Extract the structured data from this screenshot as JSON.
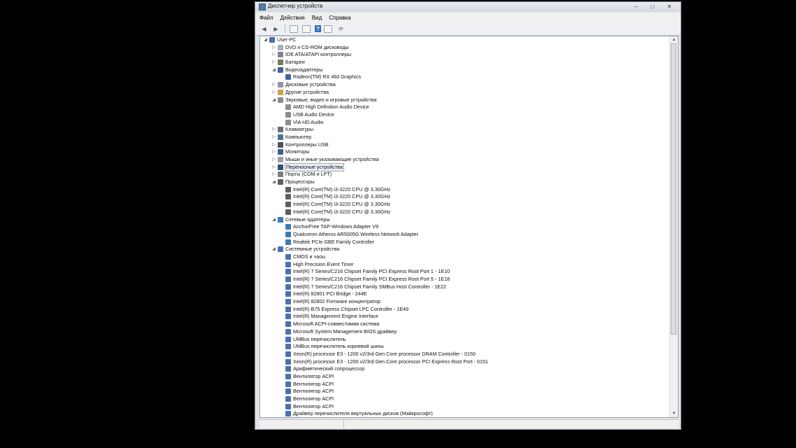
{
  "window": {
    "title": "Диспетчер устройств",
    "controls": [
      "–",
      "□",
      "✕"
    ]
  },
  "menu": [
    "Файл",
    "Действие",
    "Вид",
    "Справка"
  ],
  "toolbar": [
    "back-icon",
    "forward-icon",
    "properties-icon",
    "update-driver-icon",
    "help-icon",
    "view-icon",
    "scan-hardware-icon"
  ],
  "tree": [
    {
      "level": 0,
      "expander": "open",
      "icon": "computer",
      "label": "User-PC"
    },
    {
      "level": 1,
      "expander": "closed",
      "icon": "dvd",
      "label": "DVD и CD-ROM дисководы"
    },
    {
      "level": 1,
      "expander": "closed",
      "icon": "ide",
      "label": "IDE ATA/ATAPI контроллеры"
    },
    {
      "level": 1,
      "expander": "closed",
      "icon": "battery",
      "label": "Батареи"
    },
    {
      "level": 1,
      "expander": "open",
      "icon": "display",
      "label": "Видеоадаптеры"
    },
    {
      "level": 2,
      "expander": "none",
      "icon": "display",
      "label": "Radeon(TM) RX 460 Graphics"
    },
    {
      "level": 1,
      "expander": "closed",
      "icon": "disk",
      "label": "Дисковые устройства"
    },
    {
      "level": 1,
      "expander": "closed",
      "icon": "other",
      "label": "Другие устройства"
    },
    {
      "level": 1,
      "expander": "open",
      "icon": "sound",
      "label": "Звуковые, видео и игровые устройства"
    },
    {
      "level": 2,
      "expander": "none",
      "icon": "sound",
      "label": "AMD High Definition Audio Device"
    },
    {
      "level": 2,
      "expander": "none",
      "icon": "sound",
      "label": "USB Audio Device"
    },
    {
      "level": 2,
      "expander": "none",
      "icon": "sound",
      "label": "VIA HD Audio"
    },
    {
      "level": 1,
      "expander": "closed",
      "icon": "keyboard",
      "label": "Клавиатуры"
    },
    {
      "level": 1,
      "expander": "closed",
      "icon": "computer",
      "label": "Компьютер"
    },
    {
      "level": 1,
      "expander": "closed",
      "icon": "usb",
      "label": "Контроллеры USB"
    },
    {
      "level": 1,
      "expander": "closed",
      "icon": "monitor",
      "label": "Мониторы"
    },
    {
      "level": 1,
      "expander": "closed",
      "icon": "mouse",
      "label": "Мыши и иные указывающие устройства"
    },
    {
      "level": 1,
      "expander": "closed",
      "icon": "portable",
      "label": "Переносные устройства",
      "selected": true
    },
    {
      "level": 1,
      "expander": "closed",
      "icon": "port",
      "label": "Порты (COM и LPT)"
    },
    {
      "level": 1,
      "expander": "open",
      "icon": "cpu",
      "label": "Процессоры"
    },
    {
      "level": 2,
      "expander": "none",
      "icon": "cpu",
      "label": "Intel(R) Core(TM) i3-3220 CPU @ 3.30GHz"
    },
    {
      "level": 2,
      "expander": "none",
      "icon": "cpu",
      "label": "Intel(R) Core(TM) i3-3220 CPU @ 3.30GHz"
    },
    {
      "level": 2,
      "expander": "none",
      "icon": "cpu",
      "label": "Intel(R) Core(TM) i3-3220 CPU @ 3.30GHz"
    },
    {
      "level": 2,
      "expander": "none",
      "icon": "cpu",
      "label": "Intel(R) Core(TM) i3-3220 CPU @ 3.30GHz"
    },
    {
      "level": 1,
      "expander": "open",
      "icon": "network",
      "label": "Сетевые адаптеры"
    },
    {
      "level": 2,
      "expander": "none",
      "icon": "network",
      "label": "AnchorFree TAP-Windows Adapter V9"
    },
    {
      "level": 2,
      "expander": "none",
      "icon": "network",
      "label": "Qualcomm Atheros AR5005G Wireless Network Adapter"
    },
    {
      "level": 2,
      "expander": "none",
      "icon": "network",
      "label": "Realtek PCIe GBE Family Controller"
    },
    {
      "level": 1,
      "expander": "open",
      "icon": "system",
      "label": "Системные устройства"
    },
    {
      "level": 2,
      "expander": "none",
      "icon": "system",
      "label": "CMOS и часы"
    },
    {
      "level": 2,
      "expander": "none",
      "icon": "system",
      "label": "High Precision Event Timer"
    },
    {
      "level": 2,
      "expander": "none",
      "icon": "system",
      "label": "Intel(R) 7 Series/C216 Chipset Family PCI Express Root Port 1 - 1E10"
    },
    {
      "level": 2,
      "expander": "none",
      "icon": "system",
      "label": "Intel(R) 7 Series/C216 Chipset Family PCI Express Root Port 5 - 1E18"
    },
    {
      "level": 2,
      "expander": "none",
      "icon": "system",
      "label": "Intel(R) 7 Series/C216 Chipset Family SMBus Host Controller - 1E22"
    },
    {
      "level": 2,
      "expander": "none",
      "icon": "system",
      "label": "Intel(R) 82801 PCI Bridge - 244E"
    },
    {
      "level": 2,
      "expander": "none",
      "icon": "system",
      "label": "Intel(R) 82802 Firmware концентратор"
    },
    {
      "level": 2,
      "expander": "none",
      "icon": "system",
      "label": "Intel(R) B75 Express Chipset LPC Controller - 1E49"
    },
    {
      "level": 2,
      "expander": "none",
      "icon": "system",
      "label": "Intel(R) Management Engine Interface"
    },
    {
      "level": 2,
      "expander": "none",
      "icon": "system",
      "label": "Microsoft ACPI-совместимая система"
    },
    {
      "level": 2,
      "expander": "none",
      "icon": "system",
      "label": "Microsoft System Management BIOS драйвер"
    },
    {
      "level": 2,
      "expander": "none",
      "icon": "system",
      "label": "UMBus перечислитель"
    },
    {
      "level": 2,
      "expander": "none",
      "icon": "system",
      "label": "UMBus перечислитель корневой шины"
    },
    {
      "level": 2,
      "expander": "none",
      "icon": "system",
      "label": "Xeon(R) processor E3 - 1200 v2/3rd Gen Core processor DRAM Controller - 0150"
    },
    {
      "level": 2,
      "expander": "none",
      "icon": "system",
      "label": "Xeon(R) processor E3 - 1200 v2/3rd Gen Core processor PCI Express Root Port - 0151"
    },
    {
      "level": 2,
      "expander": "none",
      "icon": "system",
      "label": "Арифметический сопроцессор"
    },
    {
      "level": 2,
      "expander": "none",
      "icon": "system",
      "label": "Вентилятор ACPI"
    },
    {
      "level": 2,
      "expander": "none",
      "icon": "system",
      "label": "Вентилятор ACPI"
    },
    {
      "level": 2,
      "expander": "none",
      "icon": "system",
      "label": "Вентилятор ACPI"
    },
    {
      "level": 2,
      "expander": "none",
      "icon": "system",
      "label": "Вентилятор ACPI"
    },
    {
      "level": 2,
      "expander": "none",
      "icon": "system",
      "label": "Вентилятор ACPI"
    },
    {
      "level": 2,
      "expander": "none",
      "icon": "system",
      "label": "Драйвер перечислителя виртуальных дисков (Майкрософт)"
    }
  ],
  "icon_colors": {
    "computer": "#4d6f9c",
    "dvd": "#a7adb6",
    "ide": "#7f8793",
    "battery": "#6f7f55",
    "display": "#3f63a3",
    "disk": "#8f96a0",
    "other": "#c4a54a",
    "sound": "#8d8d8d",
    "keyboard": "#6b6f75",
    "usb": "#505458",
    "monitor": "#3a5f99",
    "mouse": "#9aa0a8",
    "portable": "#2f4f7f",
    "port": "#7a7f86",
    "cpu": "#5c5f63",
    "network": "#3d7cb5",
    "system": "#4a72b0"
  }
}
